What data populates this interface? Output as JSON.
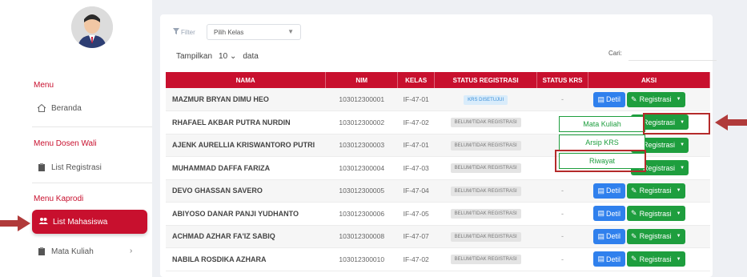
{
  "sidebar": {
    "heading_menu": "Menu",
    "item_beranda": "Beranda",
    "heading_dosen_wali": "Menu Dosen Wali",
    "item_list_registrasi": "List Registrasi",
    "heading_kaprodi": "Menu Kaprodi",
    "item_list_mahasiswa": "List Mahasiswa",
    "item_mata_kuliah": "Mata Kuliah"
  },
  "toolbar": {
    "filter_label": "Filter",
    "kelas_placeholder": "Pilih Kelas",
    "show_prefix": "Tampilkan",
    "show_count": "10",
    "show_suffix": "data",
    "search_label": "Cari:"
  },
  "table": {
    "headers": [
      "NAMA",
      "NIM",
      "KELAS",
      "STATUS REGISTRASI",
      "STATUS KRS",
      "AKSI"
    ],
    "rows": [
      {
        "nama": "MAZMUR BRYAN DIMU HEO",
        "nim": "103012300001",
        "kelas": "IF-47-01",
        "status": "KRS DISETUJUI",
        "krs": "-"
      },
      {
        "nama": "RHAFAEL AKBAR PUTRA NURDIN",
        "nim": "103012300002",
        "kelas": "IF-47-02",
        "status": "BELUM/TIDAK REGISTRASI",
        "krs": "-"
      },
      {
        "nama": "AJENK AURELLIA KRISWANTORO PUTRI",
        "nim": "103012300003",
        "kelas": "IF-47-01",
        "status": "BELUM/TIDAK REGISTRASI",
        "krs": "-"
      },
      {
        "nama": "MUHAMMAD DAFFA FARIZA",
        "nim": "103012300004",
        "kelas": "IF-47-03",
        "status": "BELUM/TIDAK REGISTRASI",
        "krs": "-"
      },
      {
        "nama": "DEVO GHASSAN SAVERO",
        "nim": "103012300005",
        "kelas": "IF-47-04",
        "status": "BELUM/TIDAK REGISTRASI",
        "krs": "-"
      },
      {
        "nama": "ABIYOSO DANAR PANJI YUDHANTO",
        "nim": "103012300006",
        "kelas": "IF-47-05",
        "status": "BELUM/TIDAK REGISTRASI",
        "krs": "-"
      },
      {
        "nama": "ACHMAD AZHAR FA'IZ SABIQ",
        "nim": "103012300008",
        "kelas": "IF-47-07",
        "status": "BELUM/TIDAK REGISTRASI",
        "krs": "-"
      },
      {
        "nama": "NABILA ROSDIKA AZHARA",
        "nim": "103012300010",
        "kelas": "IF-47-02",
        "status": "BELUM/TIDAK REGISTRASI",
        "krs": "-"
      }
    ],
    "detil_label": "Detil",
    "registrasi_label": "Registrasi"
  },
  "dropdown": {
    "items": [
      "Mata Kuliah",
      "Arsip KRS",
      "Riwayat"
    ]
  },
  "colors": {
    "brand_red": "#c8102e",
    "green": "#1e9e3e",
    "blue": "#2f80ed"
  }
}
